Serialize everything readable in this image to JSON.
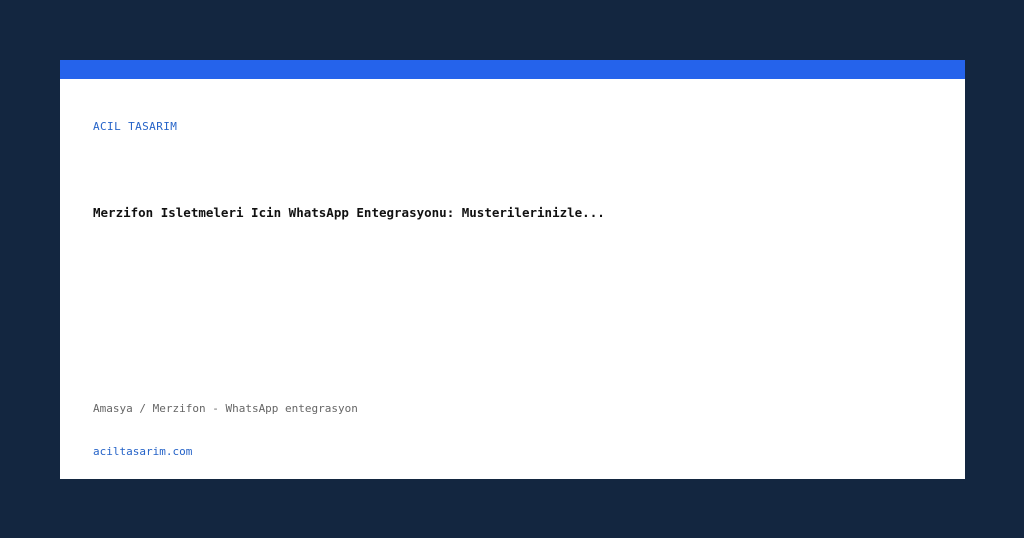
{
  "card": {
    "brand": "ACIL TASARIM",
    "headline": "Merzifon Isletmeleri Icin WhatsApp Entegrasyonu: Musterilerinizle...",
    "location": "Amasya / Merzifon - WhatsApp entegrasyon",
    "site": "aciltasarim.com"
  },
  "colors": {
    "background": "#132640",
    "accent_bar": "#2563eb",
    "brand_text": "#2563c8"
  }
}
